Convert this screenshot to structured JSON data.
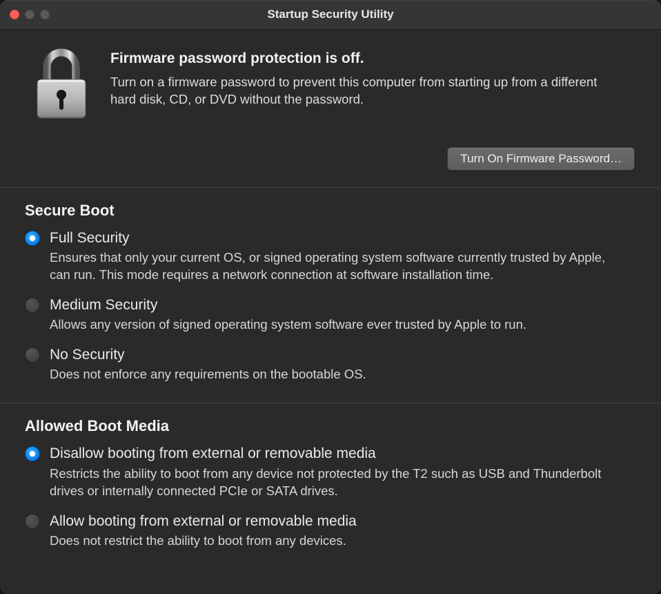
{
  "window": {
    "title": "Startup Security Utility"
  },
  "firmware": {
    "heading": "Firmware password protection is off.",
    "description": "Turn on a firmware password to prevent this computer from starting up from a different hard disk, CD, or DVD without the password.",
    "button_label": "Turn On Firmware Password…"
  },
  "secure_boot": {
    "heading": "Secure Boot",
    "options": [
      {
        "title": "Full Security",
        "description": "Ensures that only your current OS, or signed operating system software currently trusted by Apple, can run. This mode requires a network connection at software installation time.",
        "selected": true
      },
      {
        "title": "Medium Security",
        "description": "Allows any version of signed operating system software ever trusted by Apple to run.",
        "selected": false
      },
      {
        "title": "No Security",
        "description": "Does not enforce any requirements on the bootable OS.",
        "selected": false
      }
    ]
  },
  "boot_media": {
    "heading": "Allowed Boot Media",
    "options": [
      {
        "title": "Disallow booting from external or removable media",
        "description": "Restricts the ability to boot from any device not protected by the T2 such as USB and Thunderbolt drives or internally connected PCIe or SATA drives.",
        "selected": true
      },
      {
        "title": "Allow booting from external or removable media",
        "description": "Does not restrict the ability to boot from any devices.",
        "selected": false
      }
    ]
  }
}
